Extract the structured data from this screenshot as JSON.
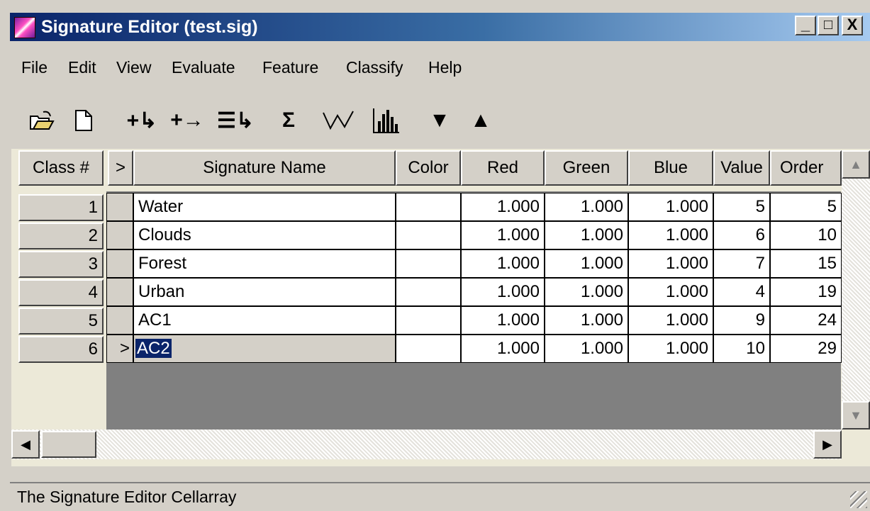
{
  "window": {
    "title": "Signature Editor (test.sig)",
    "minimize": "_",
    "maximize": "□",
    "close": "X"
  },
  "menu": [
    "File",
    "Edit",
    "View",
    "Evaluate",
    "Feature",
    "Classify",
    "Help"
  ],
  "toolbar": {
    "icons": [
      "open-folder-icon",
      "new-file-icon",
      "add-row-icon",
      "merge-icon",
      "append-icon",
      "sigma-icon",
      "line-chart-icon",
      "histogram-icon",
      "move-down-icon",
      "move-up-icon"
    ],
    "glyphs": {
      "add_row": "+↳",
      "merge": "+→",
      "append": "☰↳",
      "sigma": "Σ",
      "down": "▼",
      "up": "▲"
    }
  },
  "table": {
    "headers": {
      "class": "Class #",
      "marker": ">",
      "name": "Signature Name",
      "color": "Color",
      "red": "Red",
      "green": "Green",
      "blue": "Blue",
      "value": "Value",
      "order": "Order"
    },
    "rows": [
      {
        "num": "1",
        "marker": "",
        "name": "Water",
        "red": "1.000",
        "green": "1.000",
        "blue": "1.000",
        "value": "5",
        "order": "5"
      },
      {
        "num": "2",
        "marker": "",
        "name": "Clouds",
        "red": "1.000",
        "green": "1.000",
        "blue": "1.000",
        "value": "6",
        "order": "10"
      },
      {
        "num": "3",
        "marker": "",
        "name": "Forest",
        "red": "1.000",
        "green": "1.000",
        "blue": "1.000",
        "value": "7",
        "order": "15"
      },
      {
        "num": "4",
        "marker": "",
        "name": "Urban",
        "red": "1.000",
        "green": "1.000",
        "blue": "1.000",
        "value": "4",
        "order": "19"
      },
      {
        "num": "5",
        "marker": "",
        "name": "AC1",
        "red": "1.000",
        "green": "1.000",
        "blue": "1.000",
        "value": "9",
        "order": "24"
      },
      {
        "num": "6",
        "marker": ">",
        "name": "AC2",
        "red": "1.000",
        "green": "1.000",
        "blue": "1.000",
        "value": "10",
        "order": "29"
      }
    ]
  },
  "status": {
    "text": "The Signature Editor Cellarray"
  },
  "colors": {
    "title_start": "#0a246a",
    "title_end": "#a6caf0",
    "selection": "#0a246a",
    "face": "#d4d0c8"
  }
}
